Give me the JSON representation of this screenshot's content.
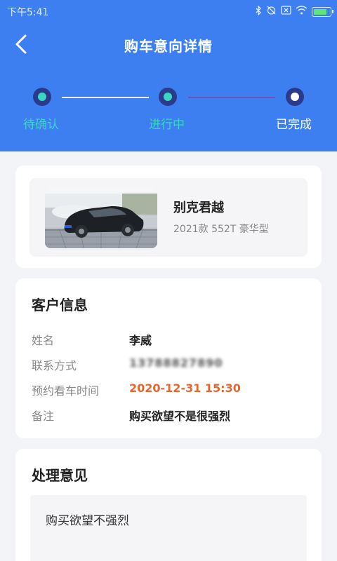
{
  "status_bar": {
    "time": "下午5:41",
    "icons": [
      "bluetooth-icon",
      "alarm-off-icon",
      "sim-icon",
      "wifi-icon",
      "battery-icon"
    ],
    "battery_color": "#5fe37a"
  },
  "header": {
    "title": "购车意向详情",
    "back_icon": "chevron-left-icon",
    "background": "#3d7ff0"
  },
  "stepper": {
    "steps": [
      {
        "label": "待确认",
        "state": "done",
        "color": "#3ad6c4"
      },
      {
        "label": "进行中",
        "state": "done",
        "color": "#3ad6c4"
      },
      {
        "label": "已完成",
        "state": "current",
        "color": "#ffffff"
      }
    ]
  },
  "car": {
    "name": "别克君越",
    "spec": "2021款 552T 豪华型"
  },
  "customer": {
    "section_title": "客户信息",
    "rows": [
      {
        "label": "姓名",
        "value": "李威"
      },
      {
        "label": "联系方式",
        "value": "13788827890"
      },
      {
        "label": "预约看车时间",
        "value": "2020-12-31 15:30"
      },
      {
        "label": "备注",
        "value": "购买欲望不是很强烈"
      }
    ]
  },
  "opinion": {
    "section_title": "处理意见",
    "text": "购买欲望不强烈"
  }
}
